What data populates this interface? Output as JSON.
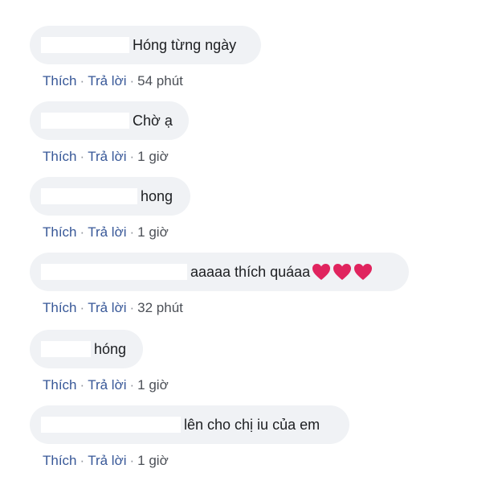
{
  "comments": [
    {
      "text": "Hóng từng ngày",
      "like_label": "Thích",
      "reply_label": "Trả lời",
      "time": "54 phút"
    },
    {
      "text": "Chờ ạ",
      "like_label": "Thích",
      "reply_label": "Trả lời",
      "time": "1 giờ"
    },
    {
      "text": "hong",
      "like_label": "Thích",
      "reply_label": "Trả lời",
      "time": "1 giờ"
    },
    {
      "text": "aaaaa thích quáaa",
      "emoji": [
        "heart-icon",
        "heart-icon",
        "heart-icon"
      ],
      "like_label": "Thích",
      "reply_label": "Trả lời",
      "time": "32 phút"
    },
    {
      "text": "hóng",
      "like_label": "Thích",
      "reply_label": "Trả lời",
      "time": "1 giờ"
    },
    {
      "text": "lên cho chị iu của em",
      "like_label": "Thích",
      "reply_label": "Trả lời",
      "time": "1 giờ"
    }
  ],
  "separator": "·",
  "colors": {
    "bubble_bg": "#f0f2f5",
    "link": "#385898",
    "text": "#1c1e21",
    "heart": "#e0245e"
  }
}
